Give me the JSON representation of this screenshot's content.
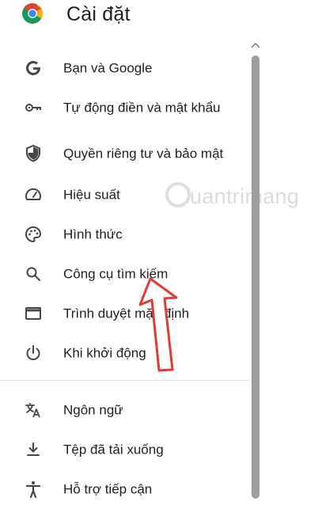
{
  "header": {
    "title": "Cài đặt",
    "logo_icon": "chrome-icon"
  },
  "nav": {
    "items": [
      {
        "label": "Bạn và Google",
        "icon": "google-g-icon"
      },
      {
        "label": "Tự động điền và mật khẩu",
        "icon": "key-icon"
      },
      {
        "label": "Quyền riêng tư và bảo mật",
        "icon": "shield-icon"
      },
      {
        "label": "Hiệu suất",
        "icon": "speedometer-icon"
      },
      {
        "label": "Hình thức",
        "icon": "palette-icon"
      },
      {
        "label": "Công cụ tìm kiếm",
        "icon": "search-icon"
      },
      {
        "label": "Trình duyệt mặc định",
        "icon": "browser-window-icon"
      },
      {
        "label": "Khi khởi động",
        "icon": "power-icon"
      },
      {
        "label": "Ngôn ngữ",
        "icon": "translate-icon"
      },
      {
        "label": "Tệp đã tải xuống",
        "icon": "download-icon"
      },
      {
        "label": "Hỗ trợ tiếp cận",
        "icon": "accessibility-icon"
      }
    ]
  },
  "watermark": {
    "text": "uantrimang"
  },
  "colors": {
    "icon": "#474747",
    "text": "#1f1f1f",
    "arrow": "#e53935",
    "scrollbar": "#9e9e9e"
  }
}
